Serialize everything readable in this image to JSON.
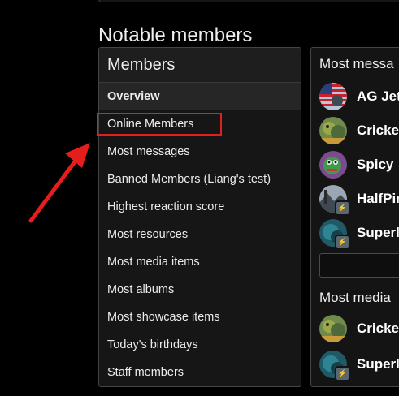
{
  "page": {
    "title": "Notable members"
  },
  "members": {
    "header": "Members",
    "items": [
      {
        "label": "Overview",
        "active": true
      },
      {
        "label": "Online Members",
        "highlighted": true
      },
      {
        "label": "Most messages"
      },
      {
        "label": "Banned Members (Liang's test)"
      },
      {
        "label": "Highest reaction score"
      },
      {
        "label": "Most resources"
      },
      {
        "label": "Most media items"
      },
      {
        "label": "Most albums"
      },
      {
        "label": "Most showcase items"
      },
      {
        "label": "Today's birthdays"
      },
      {
        "label": "Staff members"
      }
    ]
  },
  "right_panel": {
    "most_messages": {
      "title": "Most messa",
      "members": [
        {
          "name": "AG Jet",
          "avatar": "flag-avatar"
        },
        {
          "name": "Cricke",
          "avatar": "frog-avatar"
        },
        {
          "name": "Spicy",
          "avatar": "frog-purple-avatar"
        },
        {
          "name": "HalfPir",
          "avatar": "landscape-avatar",
          "badge": "lightning-icon"
        },
        {
          "name": "Superl",
          "avatar": "teal-avatar",
          "badge": "lightning-icon"
        }
      ]
    },
    "most_media": {
      "title": "Most media",
      "members": [
        {
          "name": "Cricke",
          "avatar": "frog-avatar"
        },
        {
          "name": "Superl",
          "avatar": "teal-avatar",
          "badge": "lightning-icon"
        }
      ]
    }
  },
  "annotation": {
    "highlight_color": "#e41d1d",
    "arrow_color": "#e41d1d"
  },
  "badge_glyph": "⚡"
}
